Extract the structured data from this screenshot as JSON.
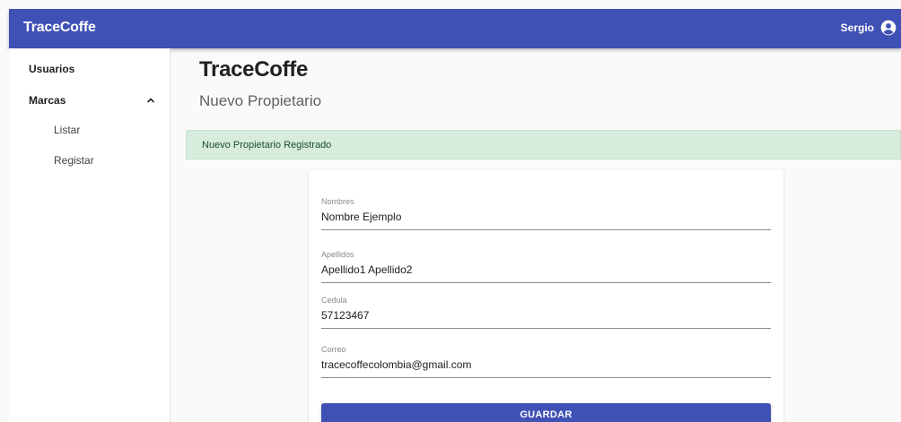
{
  "appbar": {
    "brand": "TraceCoffe",
    "user_name": "Sergio",
    "user_icon": "account-circle-icon",
    "color": "#3f51b5"
  },
  "sidebar": {
    "items": [
      {
        "label": "Usuarios"
      },
      {
        "label": "Marcas",
        "expanded": true,
        "icon": "chevron-up-icon",
        "children": [
          {
            "label": "Listar"
          },
          {
            "label": "Registar"
          }
        ]
      }
    ]
  },
  "main": {
    "title": "TraceCoffe",
    "subtitle": "Nuevo Propietario",
    "alert": {
      "text": "Nuevo Propietario Registrado",
      "color": "#d7ecdc"
    },
    "form": {
      "fields": [
        {
          "label": "Nombres",
          "value": "Nombre Ejemplo"
        },
        {
          "label": "Apellidos",
          "value": "Apellido1 Apellido2"
        },
        {
          "label": "Cedula",
          "value": "57123467"
        },
        {
          "label": "Correo",
          "value": "tracecoffecolombia@gmail.com"
        }
      ],
      "submit_label": "GUARDAR"
    }
  }
}
